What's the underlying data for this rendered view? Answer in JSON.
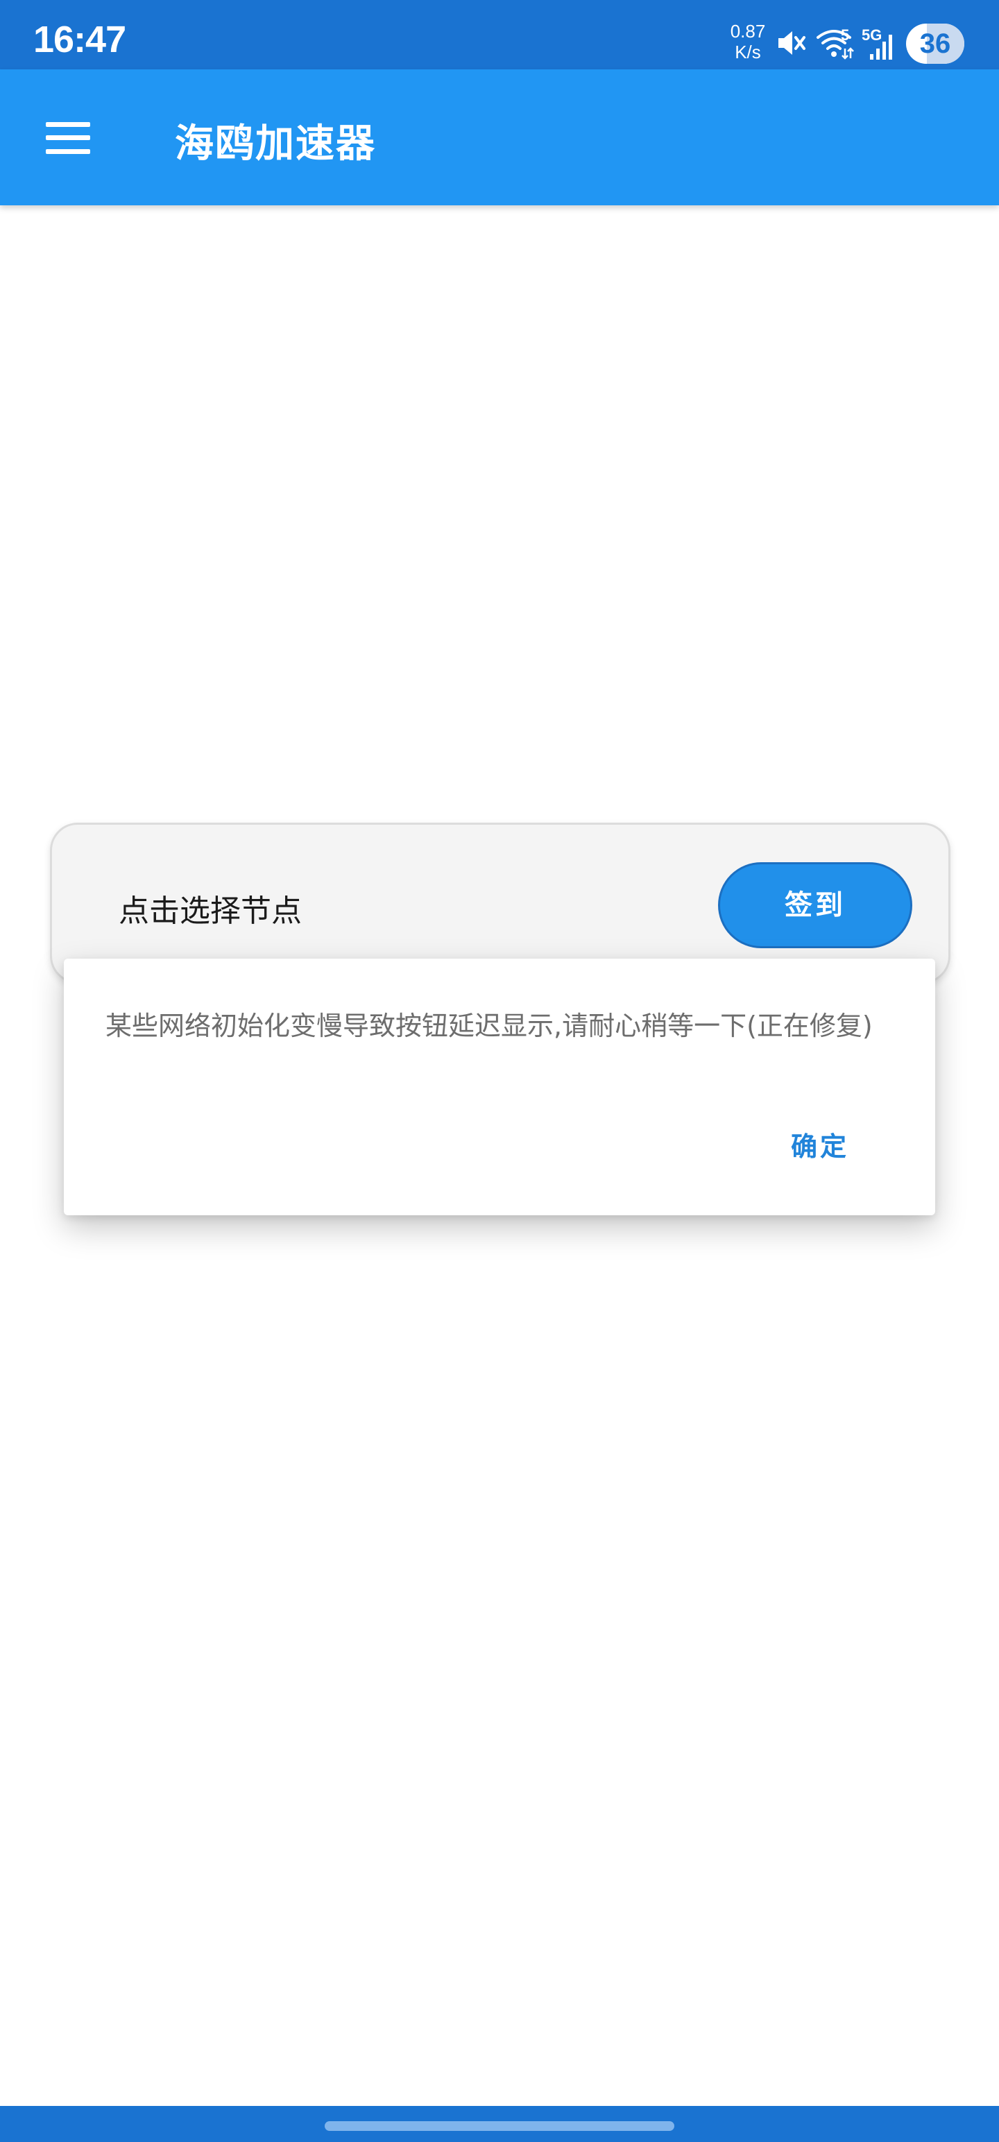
{
  "status_bar": {
    "time": "16:47",
    "net_speed_value": "0.87",
    "net_speed_unit": "K/s",
    "network_type": "5G",
    "wifi_badge": "5",
    "battery_level": "36"
  },
  "app_bar": {
    "title": "海鸥加速器"
  },
  "card": {
    "node_label": "点击选择节点",
    "checkin_label": "签到"
  },
  "dialog": {
    "message": "某些网络初始化变慢导致按钮延迟显示,请耐心稍等一下(正在修复)",
    "confirm_label": "确定"
  },
  "colors": {
    "status_bar": "#1a73d1",
    "app_bar": "#2196f3",
    "accent": "#2190ea",
    "confirm_text": "#2184da"
  }
}
